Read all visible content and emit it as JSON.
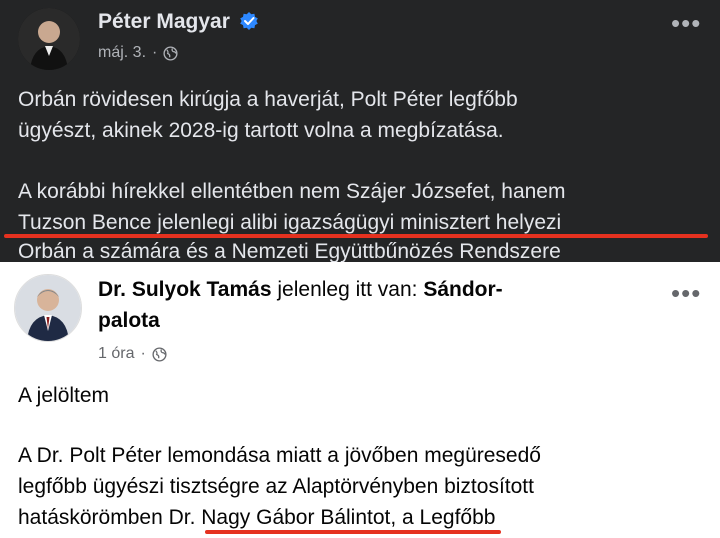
{
  "post1": {
    "author": "Péter Magyar",
    "timestamp": "máj. 3.",
    "separator": "·",
    "privacy_icon": "globe-icon",
    "verified_icon": "verified-badge-icon",
    "more_icon": "more-options-icon",
    "lines": [
      "Orbán rövidesen kirúgja a haverját, Polt Péter legfőbb",
      "ügyészt, akinek 2028-ig tartott volna a megbízatása.",
      "A korábbi hírekkel ellentétben nem Szájer Józsefet, hanem",
      "Tuzson Bence jelenlegi alibi igazságügyi minisztert helyezi",
      "Orbán a számára és a Nemzeti Együttbűnözés Rendszere"
    ]
  },
  "post2": {
    "author": "Dr. Sulyok Tamás",
    "location_prefix": "jelenleg itt van:",
    "location_line1": "Sándor-",
    "location_line2": "palota",
    "timestamp": "1 óra",
    "separator": "·",
    "privacy_icon": "globe-icon",
    "more_icon": "more-options-icon",
    "lines": [
      "A jelöltem",
      "A Dr. Polt Péter lemondása miatt a jövőben megüresedő",
      "legfőbb ügyészi tisztségre az Alaptörvényben biztosított",
      "hatáskörömben Dr. Nagy Gábor Bálintot, a Legfőbb"
    ]
  },
  "colors": {
    "dark_bg": "#242526",
    "dark_text": "#e4e6eb",
    "dark_meta": "#b0b3b8",
    "light_text": "#050505",
    "light_meta": "#65676b",
    "verified": "#2d88ff",
    "highlight_red": "#e5311f"
  },
  "more_glyph": "•••"
}
